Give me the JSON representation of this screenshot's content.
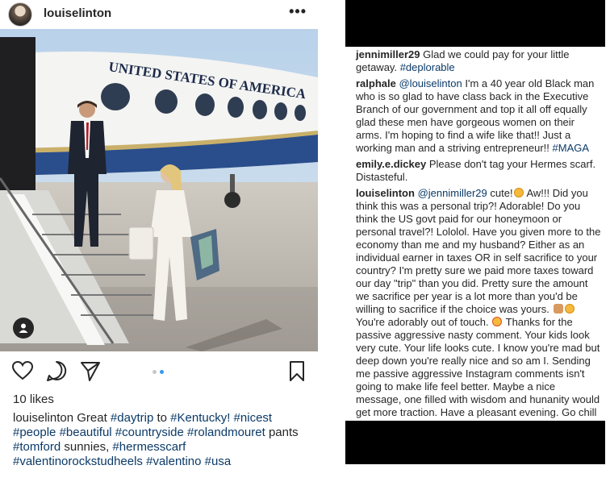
{
  "post": {
    "username": "louiselinton",
    "more_label": "•••",
    "plane_text": "UNITED STATES OF AMERICA",
    "likes": "10 likes",
    "caption_user": "louiselinton",
    "caption_text": "Great",
    "caption_to": "to",
    "caption_pants": "pants",
    "caption_sunnies": "sunnies,",
    "hashtags": {
      "daytrip": "#daytrip",
      "kentucky": "#Kentucky!",
      "nicest": "#nicest",
      "people": "#people",
      "beautiful": "#beautiful",
      "countryside": "#countryside",
      "rolandmouret": "#rolandmouret",
      "tomford": "#tomford",
      "hermesscarf": "#hermesscarf",
      "valentinorockstudheels": "#valentinorockstudheels",
      "valentino": "#valentino",
      "usa": "#usa"
    },
    "carousel_dots": 2,
    "carousel_active": 2
  },
  "comments": [
    {
      "user": "jennimiller29",
      "text": "Glad we could pay for your little getaway.",
      "tag": "#deplorable"
    },
    {
      "user": "ralphale",
      "mention": "@louiselinton",
      "text": "I'm a 40 year old Black man who is so glad to have class back in the Executive Branch of our government and top it all off equally glad these men have gorgeous women on their arms. I'm hoping to find a wife like that!! Just a working man and a striving entrepreneur!!",
      "tag": "#MAGA"
    },
    {
      "user": "emily.e.dickey",
      "text": "Please don't tag your Hermes scarf. Distasteful."
    },
    {
      "user": "louiselinton",
      "mention": "@jennimiller29",
      "text1": "cute!",
      "text2": "Aw!!! Did you think this was a personal trip?! Adorable! Do you think the US govt paid for our honeymoon or personal travel?! Lololol. Have you given more to the economy than me and my husband? Either as an individual earner in taxes OR in self sacrifice to your country? I'm pretty sure we paid more taxes toward our day \"trip\" than you did. Pretty sure the amount we sacrifice per year is a lot more than you'd be willing to sacrifice if the choice was yours.",
      "text3": "You're adorably out of touch.",
      "text4": "Thanks for the passive aggressive nasty comment. Your kids look very cute. Your life looks cute. I know you're mad but deep down you're really nice and so am I. Sending me passive aggressive Instagram comments isn't going to make life feel better. Maybe a nice message, one filled with wisdom and hunanity would get more traction. Have a pleasant evening. Go chill out and watch the new game of thrones. It's fab!"
    }
  ],
  "colors": {
    "hashtag": "#0b3a68",
    "dot_active": "#3897f0",
    "dot_inactive": "#c7c7c7"
  },
  "icons": [
    "heart-icon",
    "comment-icon",
    "share-icon",
    "bookmark-icon",
    "user-tag-icon",
    "more-icon"
  ]
}
